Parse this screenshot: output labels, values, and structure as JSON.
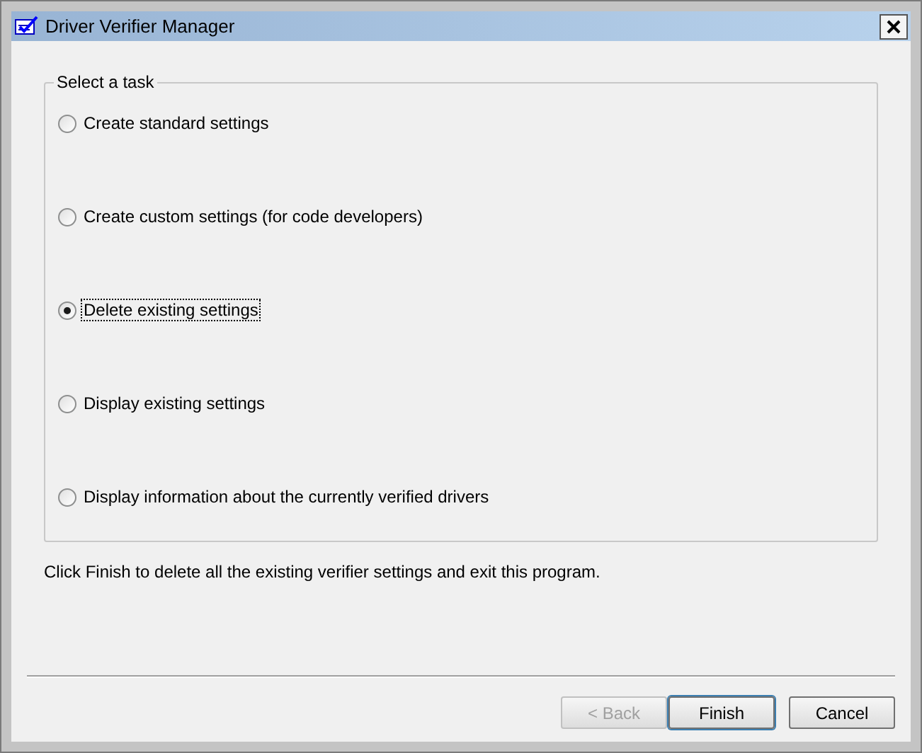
{
  "window": {
    "title": "Driver Verifier Manager"
  },
  "group": {
    "label": "Select a task"
  },
  "options": [
    {
      "label": "Create standard settings",
      "selected": false
    },
    {
      "label": "Create custom settings (for code developers)",
      "selected": false
    },
    {
      "label": "Delete existing settings",
      "selected": true
    },
    {
      "label": "Display existing settings",
      "selected": false
    },
    {
      "label": "Display information about the currently verified drivers",
      "selected": false
    }
  ],
  "hint": "Click Finish to delete all the existing verifier settings and exit this program.",
  "buttons": [
    {
      "label": "< Back",
      "disabled": true,
      "default": false
    },
    {
      "label": "Finish",
      "disabled": false,
      "default": true
    },
    {
      "label": "Cancel",
      "disabled": false,
      "default": false
    }
  ]
}
